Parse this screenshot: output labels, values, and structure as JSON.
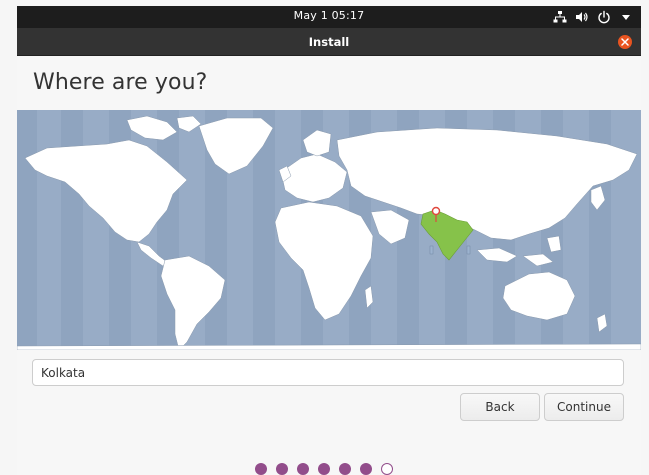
{
  "topbar": {
    "clock": "May 1  05:17",
    "icons": [
      "network-icon",
      "volume-icon",
      "power-icon",
      "menu-arrow-icon"
    ]
  },
  "window": {
    "title": "Install",
    "close_icon": "close-icon",
    "close_color": "#e95420"
  },
  "page": {
    "heading": "Where are you?"
  },
  "map": {
    "selected_region": "India",
    "highlight_color": "#86c24a",
    "ocean_color": "#98acc6"
  },
  "location": {
    "value": "Kolkata"
  },
  "buttons": {
    "back": "Back",
    "continue": "Continue"
  },
  "progress": {
    "total_steps": 7,
    "completed_steps": 6,
    "accent": "#924d8b"
  }
}
